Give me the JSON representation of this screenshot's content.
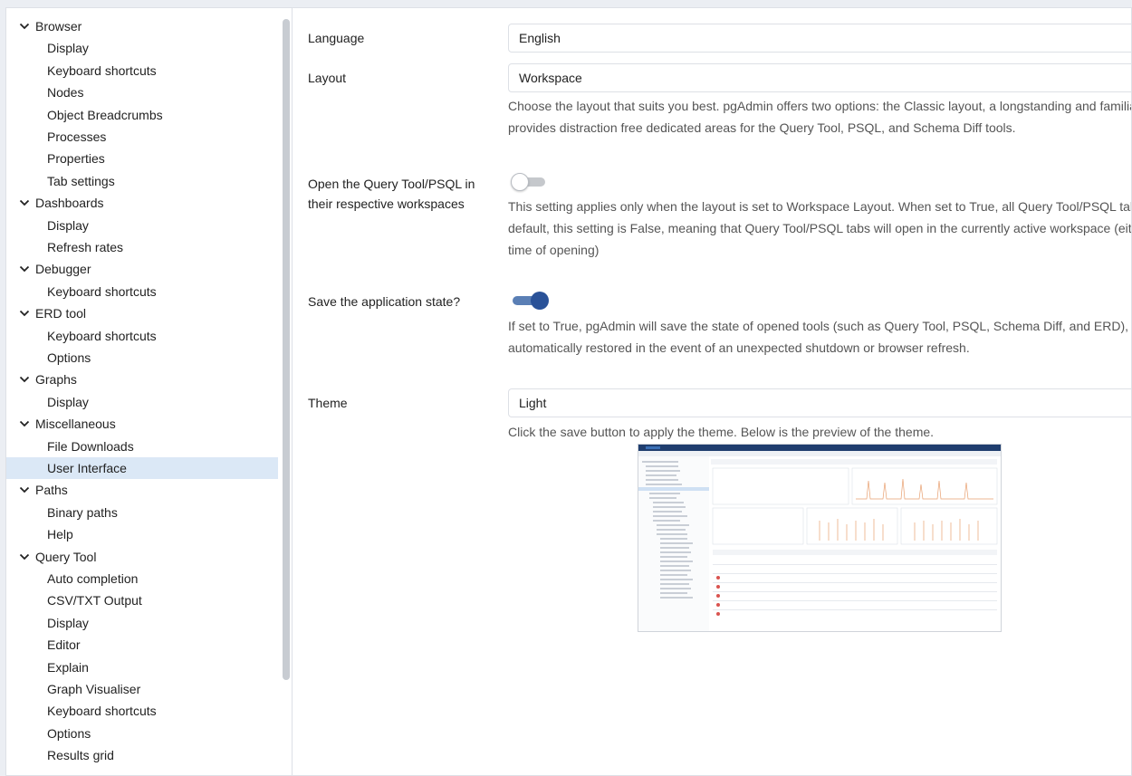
{
  "sidebar": {
    "items": [
      {
        "label": "Browser",
        "type": "category"
      },
      {
        "label": "Display",
        "type": "child"
      },
      {
        "label": "Keyboard shortcuts",
        "type": "child"
      },
      {
        "label": "Nodes",
        "type": "child"
      },
      {
        "label": "Object Breadcrumbs",
        "type": "child"
      },
      {
        "label": "Processes",
        "type": "child"
      },
      {
        "label": "Properties",
        "type": "child"
      },
      {
        "label": "Tab settings",
        "type": "child"
      },
      {
        "label": "Dashboards",
        "type": "category"
      },
      {
        "label": "Display",
        "type": "child"
      },
      {
        "label": "Refresh rates",
        "type": "child"
      },
      {
        "label": "Debugger",
        "type": "category"
      },
      {
        "label": "Keyboard shortcuts",
        "type": "child"
      },
      {
        "label": "ERD tool",
        "type": "category"
      },
      {
        "label": "Keyboard shortcuts",
        "type": "child"
      },
      {
        "label": "Options",
        "type": "child"
      },
      {
        "label": "Graphs",
        "type": "category"
      },
      {
        "label": "Display",
        "type": "child"
      },
      {
        "label": "Miscellaneous",
        "type": "category"
      },
      {
        "label": "File Downloads",
        "type": "child"
      },
      {
        "label": "User Interface",
        "type": "child",
        "selected": true
      },
      {
        "label": "Paths",
        "type": "category"
      },
      {
        "label": "Binary paths",
        "type": "child"
      },
      {
        "label": "Help",
        "type": "child"
      },
      {
        "label": "Query Tool",
        "type": "category"
      },
      {
        "label": "Auto completion",
        "type": "child"
      },
      {
        "label": "CSV/TXT Output",
        "type": "child"
      },
      {
        "label": "Display",
        "type": "child"
      },
      {
        "label": "Editor",
        "type": "child"
      },
      {
        "label": "Explain",
        "type": "child"
      },
      {
        "label": "Graph Visualiser",
        "type": "child"
      },
      {
        "label": "Keyboard shortcuts",
        "type": "child"
      },
      {
        "label": "Options",
        "type": "child"
      },
      {
        "label": "Results grid",
        "type": "child"
      }
    ]
  },
  "settings": {
    "language": {
      "label": "Language",
      "value": "English"
    },
    "layout": {
      "label": "Layout",
      "value": "Workspace",
      "help": "Choose the layout that suits you best. pgAdmin offers two options: the Classic layout, a longstanding and familiar design, and the Workspace layout, which provides distraction free dedicated areas for the Query Tool, PSQL, and Schema Diff tools."
    },
    "open_in_workspace": {
      "label": "Open the Query Tool/PSQL in their respective workspaces",
      "enabled": false,
      "help": "This setting applies only when the layout is set to Workspace Layout. When set to True, all Query Tool/PSQL tabs will open in their respective workspaces. By default, this setting is False, meaning that Query Tool/PSQL tabs will open in the currently active workspace (either the default or the workspace selected at the time of opening)"
    },
    "save_state": {
      "label": "Save the application state?",
      "enabled": true,
      "help": "If set to True, pgAdmin will save the state of opened tools (such as Query Tool, PSQL, Schema Diff, and ERD), including any unsaved data. This data will be automatically restored in the event of an unexpected shutdown or browser refresh."
    },
    "theme": {
      "label": "Theme",
      "value": "Light",
      "help": "Click the save button to apply the theme. Below is the preview of the theme."
    }
  },
  "colors": {
    "accent": "#2a5298",
    "selected_bg": "#dbe8f6",
    "preview_header": "#1f3d6e"
  },
  "icons": {
    "chevron": "chevron-down-icon",
    "dropdown": "dropdown-arrow-icon"
  }
}
